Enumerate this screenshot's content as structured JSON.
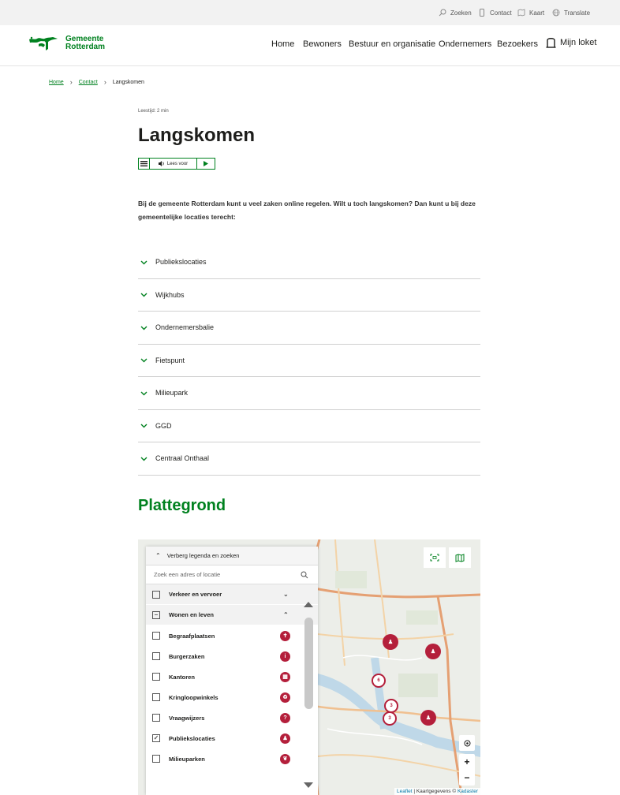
{
  "utility": {
    "zoeken": "Zoeken",
    "contact": "Contact",
    "kaart": "Kaart",
    "translate": "Translate"
  },
  "header": {
    "logo_line1": "Gemeente",
    "logo_line2": "Rotterdam",
    "nav": [
      "Home",
      "Bewoners",
      "Bestuur en organisatie",
      "Ondernemers",
      "Bezoekers"
    ],
    "loket": "Mijn loket"
  },
  "breadcrumb": {
    "items": [
      "Home",
      "Contact"
    ],
    "current": "Langskomen"
  },
  "page": {
    "leestijd": "Leestijd: 2 min",
    "title": "Langskomen",
    "lees_voor": "Lees voor",
    "intro": "Bij de gemeente Rotterdam kunt u veel zaken online regelen. Wilt u toch langskomen? Dan kunt u bij deze gemeentelijke locaties terecht:"
  },
  "accordion": [
    "Publiekslocaties",
    "Wijkhubs",
    "Ondernemersbalie",
    "Fietspunt",
    "Milieupark",
    "GGD",
    "Centraal Onthaal"
  ],
  "map": {
    "heading": "Plattegrond",
    "legend_toggle": "Verberg legenda en zoeken",
    "search_placeholder": "Zoek een adres of locatie",
    "categories": [
      {
        "label": "Verkeer en vervoer",
        "expanded": false
      },
      {
        "label": "Wonen en leven",
        "expanded": true
      }
    ],
    "layers": [
      {
        "label": "Begraafplaatsen",
        "checked": false
      },
      {
        "label": "Burgerzaken",
        "checked": false
      },
      {
        "label": "Kantoren",
        "checked": false
      },
      {
        "label": "Kringloopwinkels",
        "checked": false
      },
      {
        "label": "Vraagwijzers",
        "checked": false
      },
      {
        "label": "Publiekslocaties",
        "checked": true
      },
      {
        "label": "Milieuparken",
        "checked": false
      }
    ],
    "clusters": [
      "6",
      "3",
      "3"
    ],
    "zoom_in": "+",
    "zoom_out": "−",
    "attribution_leaflet": "Leaflet",
    "attribution_text": " | Kaartgegevens © ",
    "attribution_kadaster": "Kadaster"
  },
  "colors": {
    "brand_green": "#00811f",
    "marker_red": "#b41f3b"
  }
}
